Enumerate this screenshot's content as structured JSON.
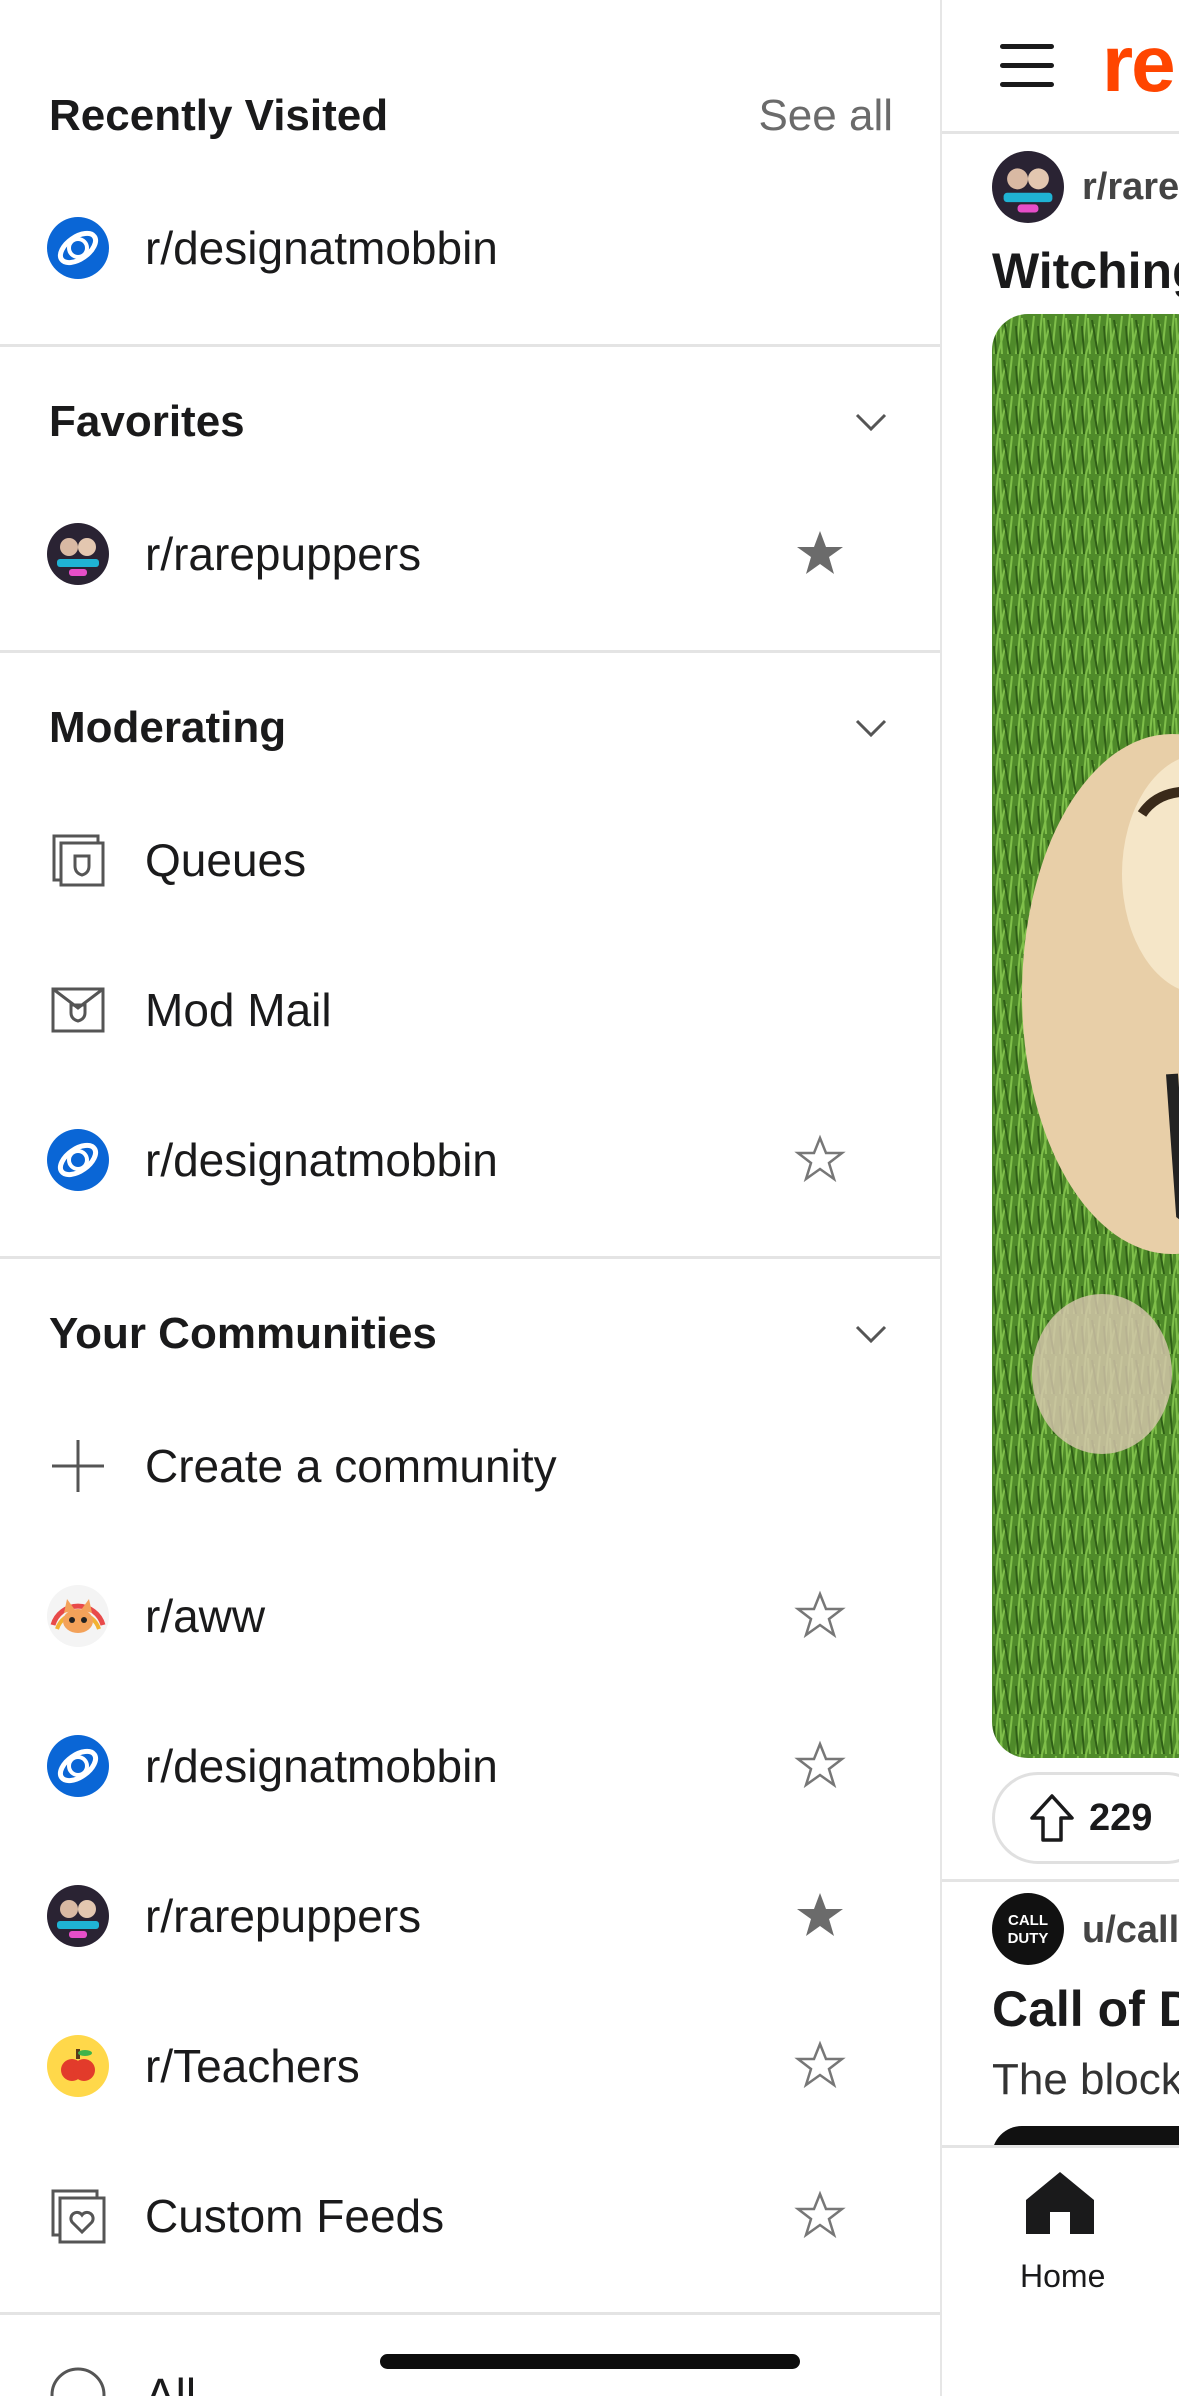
{
  "drawer": {
    "recently_visited": {
      "title": "Recently Visited",
      "see_all": "See all",
      "items": [
        {
          "label": "r/designatmobbin",
          "icon": "planet-avatar"
        }
      ]
    },
    "favorites": {
      "title": "Favorites",
      "items": [
        {
          "label": "r/rarepuppers",
          "icon": "community-avatar",
          "favorited": true
        }
      ]
    },
    "moderating": {
      "title": "Moderating",
      "items": [
        {
          "label": "Queues",
          "icon": "queues-icon"
        },
        {
          "label": "Mod Mail",
          "icon": "modmail-icon"
        },
        {
          "label": "r/designatmobbin",
          "icon": "planet-avatar",
          "favorited": false
        }
      ]
    },
    "your_communities": {
      "title": "Your Communities",
      "items": [
        {
          "label": "Create a community",
          "icon": "plus-icon"
        },
        {
          "label": "r/aww",
          "icon": "aww-avatar",
          "favorited": false
        },
        {
          "label": "r/designatmobbin",
          "icon": "planet-avatar",
          "favorited": false
        },
        {
          "label": "r/rarepuppers",
          "icon": "community-avatar",
          "favorited": true
        },
        {
          "label": "r/Teachers",
          "icon": "apple-avatar",
          "favorited": false
        },
        {
          "label": "Custom Feeds",
          "icon": "custom-feeds-icon",
          "favorited": false
        }
      ]
    },
    "partial_last_item": "All"
  },
  "feed": {
    "logo_text": "re",
    "post1": {
      "subreddit": "r/rare",
      "title": "Witching",
      "votes": "229"
    },
    "post2": {
      "user": "u/call",
      "title": "Call of D",
      "body": "The block"
    },
    "nav": {
      "home_label": "Home"
    }
  },
  "colors": {
    "brand": "#ff4500",
    "planet_blue": "#0a66d6",
    "star_filled": "#6b6b6b"
  }
}
